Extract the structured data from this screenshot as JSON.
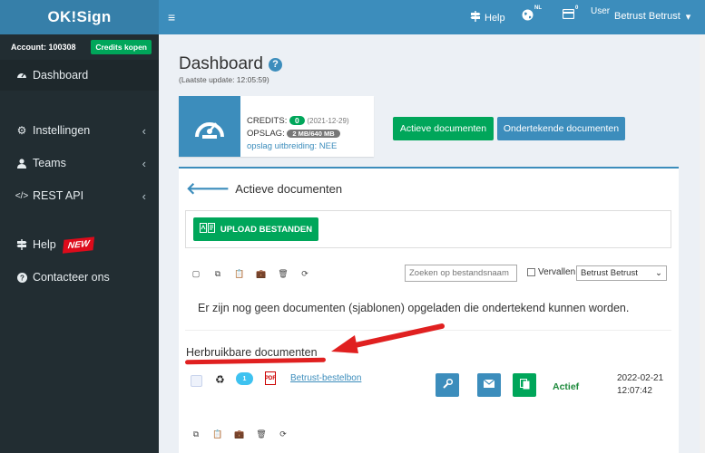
{
  "brand": {
    "logo": "OK!Sign"
  },
  "account": {
    "label": "Account: 100308",
    "credits_button": "Credits kopen"
  },
  "sidebar": {
    "items": [
      {
        "label": "Dashboard",
        "icon": "dashboard-icon"
      },
      {
        "label": "Instellingen",
        "icon": "cogs-icon"
      },
      {
        "label": "Teams",
        "icon": "user-icon"
      },
      {
        "label": "REST API",
        "icon": "code-icon"
      },
      {
        "label": "Help",
        "icon": "signpost-icon",
        "badge": "NEW"
      },
      {
        "label": "Contacteer ons",
        "icon": "question-circle-icon"
      }
    ]
  },
  "topbar": {
    "help_label": "Help",
    "language": "NL",
    "card_count": "0",
    "user_image_alt": "User",
    "user_name": "Betrust Betrust"
  },
  "page": {
    "title": "Dashboard",
    "last_update": "(Laatste update: 12:05:59)"
  },
  "info": {
    "credits_label": "CREDITS:",
    "credits_value": "0",
    "credits_date": "(2021-12-29)",
    "storage_label": "OPSLAG:",
    "storage_value": "2 MB/640 MB",
    "storage_extension": "opslag uitbreiding: NEE"
  },
  "buttons": {
    "active_docs": "Actieve documenten",
    "signed_docs": "Ondertekende documenten",
    "upload": "UPLOAD BESTANDEN"
  },
  "section": {
    "title": "Actieve documenten",
    "search_placeholder": "Zoeken op bestandsnaam",
    "expired_label": "Vervallen",
    "user_filter": "Betrust Betrust",
    "empty_message": "Er zijn nog geen documenten (sjablonen) opgeladen die ondertekend kunnen worden."
  },
  "reusable": {
    "title": "Herbruikbare documenten",
    "documents": [
      {
        "count": "1",
        "name": "Betrust-bestelbon",
        "status": "Actief",
        "date": "2022-02-21",
        "time": "12:07:42"
      }
    ]
  },
  "colors": {
    "primary": "#3c8dbc",
    "success": "#00a65a",
    "sidebar": "#222d32",
    "annotation": "#e02020"
  }
}
